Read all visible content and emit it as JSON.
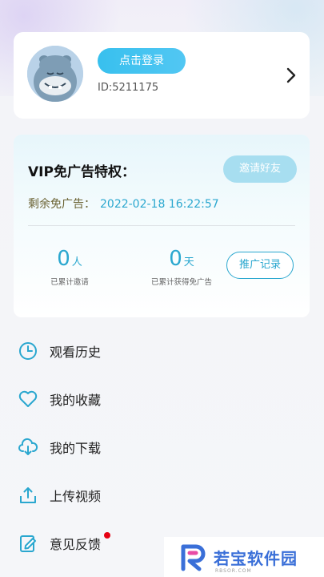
{
  "profile": {
    "login_label": "点击登录",
    "user_id": "ID:5211175"
  },
  "vip": {
    "title": "VIP免广告特权：",
    "invite_label": "邀请好友",
    "remain_label": "剩余免广告：",
    "remain_value": "2022-02-18 16:22:57",
    "stats": [
      {
        "num": "0",
        "unit": "人",
        "label": "已累计邀请"
      },
      {
        "num": "0",
        "unit": "天",
        "label": "已累计获得免广告"
      }
    ],
    "promo_label": "推广记录"
  },
  "menu": {
    "items": [
      {
        "label": "观看历史",
        "icon": "clock-icon"
      },
      {
        "label": "我的收藏",
        "icon": "heart-icon"
      },
      {
        "label": "我的下载",
        "icon": "cloud-download-icon"
      },
      {
        "label": "上传视频",
        "icon": "upload-icon"
      },
      {
        "label": "意见反馈",
        "icon": "feedback-icon"
      }
    ]
  },
  "watermark": {
    "text": "若宝软件园",
    "sub": "RBSOR.COM"
  },
  "colors": {
    "accent": "#2aa7cf",
    "login_button": "#38c0ee",
    "invite_button": "#a7def0",
    "badge": "#e60012"
  }
}
